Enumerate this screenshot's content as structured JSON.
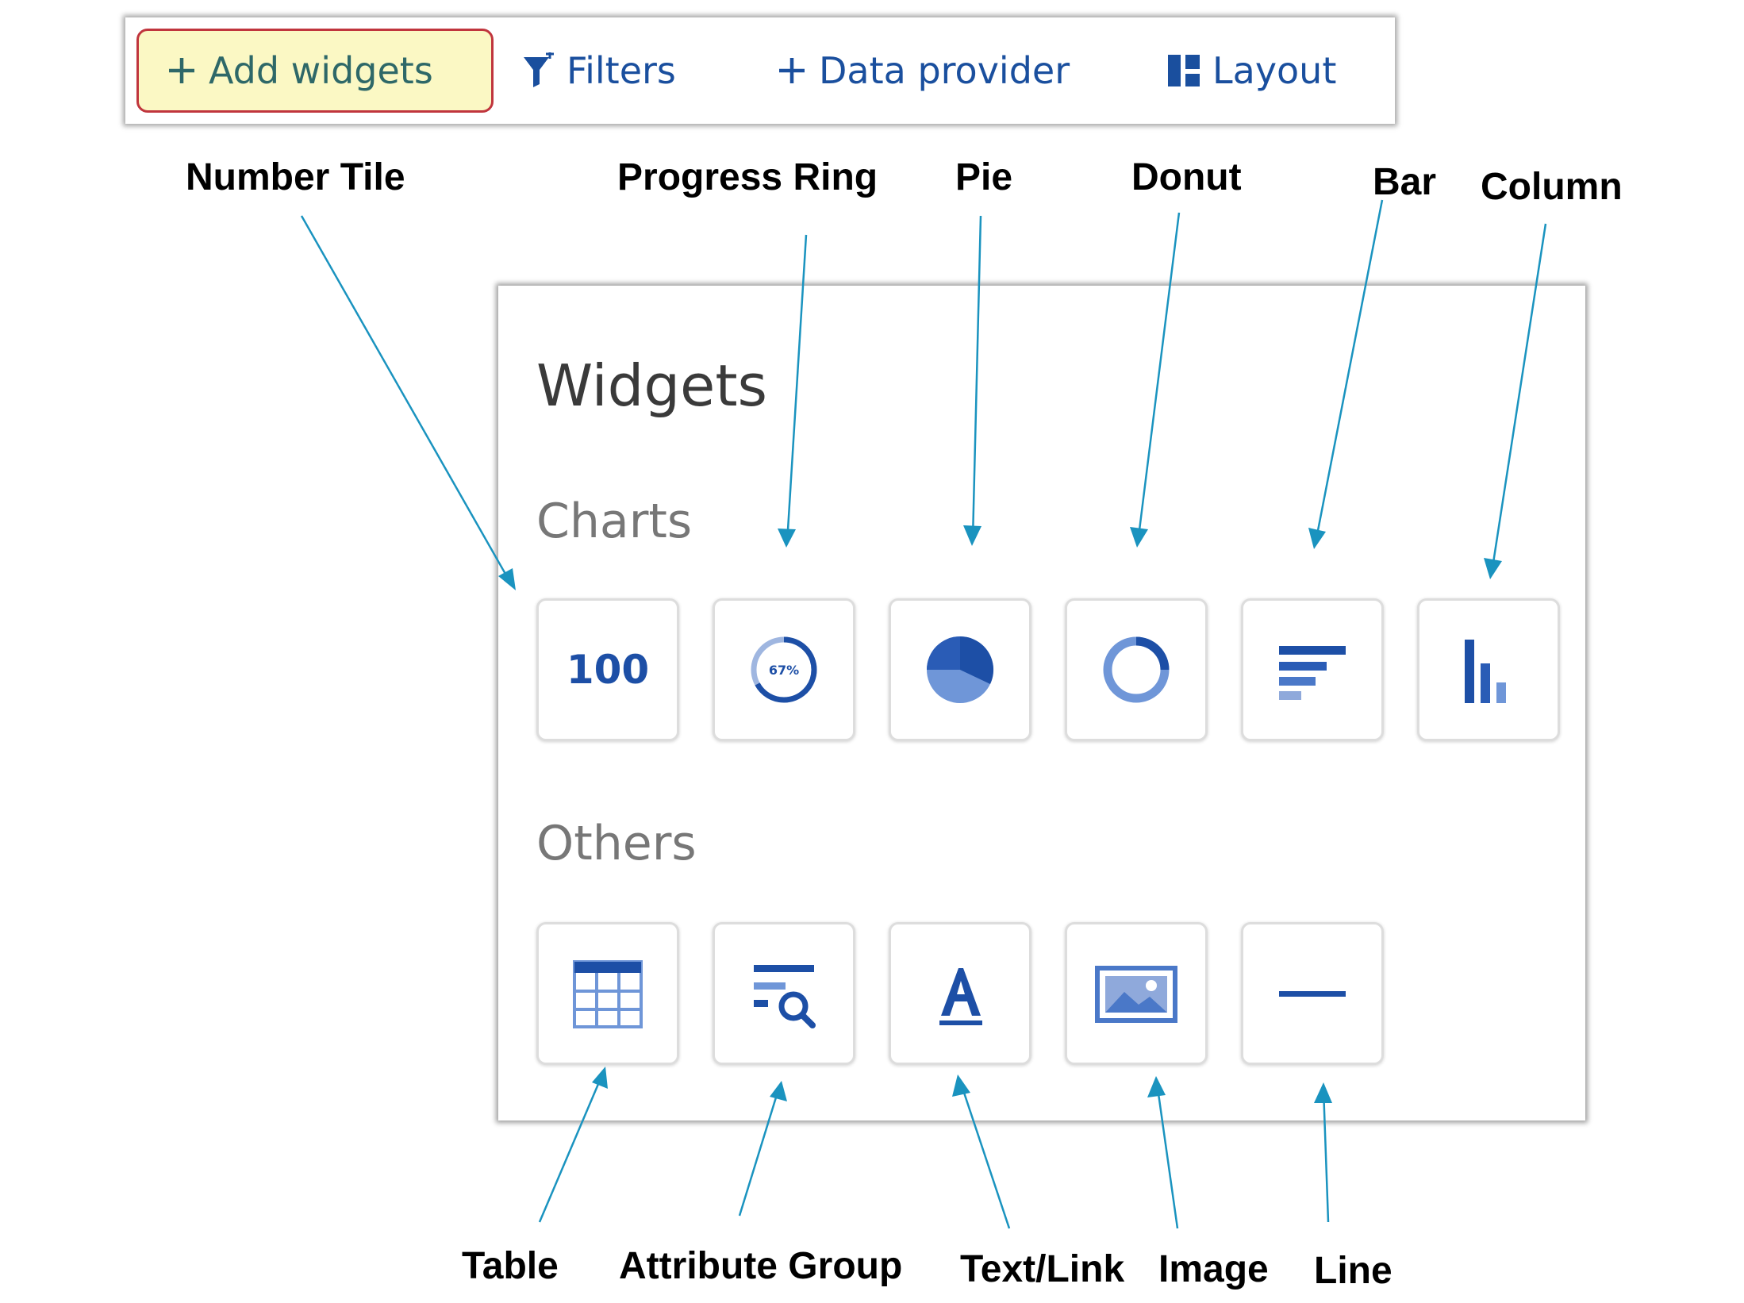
{
  "toolbar": {
    "add_widgets": "Add widgets",
    "filters": "Filters",
    "data_provider": "Data provider",
    "layout": "Layout"
  },
  "callouts": {
    "number_tile": "Number Tile",
    "progress_ring": "Progress Ring",
    "pie": "Pie",
    "donut": "Donut",
    "bar": "Bar",
    "column": "Column",
    "table": "Table",
    "attribute_group": "Attribute Group",
    "text_link": "Text/Link",
    "image": "Image",
    "line": "Line"
  },
  "panel": {
    "title": "Widgets",
    "charts_heading": "Charts",
    "others_heading": "Others",
    "number_tile_value": "100",
    "progress_ring_value": "67%"
  },
  "colors": {
    "accent": "#1d4fa6",
    "arrow": "#1a93bf",
    "add_button_bg": "#fbf8c4",
    "add_button_border": "#c0353d"
  }
}
